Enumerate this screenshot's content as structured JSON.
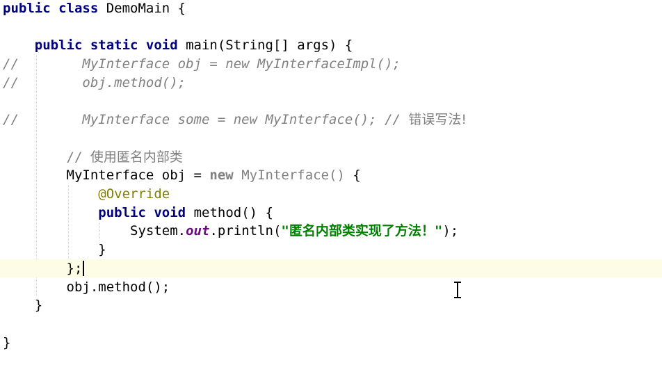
{
  "editor": {
    "language": "java",
    "lines": [
      {
        "tokens": [
          {
            "t": "public class",
            "c": "kw"
          },
          {
            "t": " DemoMain {",
            "c": ""
          }
        ]
      },
      {
        "tokens": []
      },
      {
        "tokens": [
          {
            "t": "    ",
            "c": ""
          },
          {
            "t": "public static void",
            "c": "kw"
          },
          {
            "t": " main(String[] args) {",
            "c": ""
          }
        ]
      },
      {
        "tokens": [
          {
            "t": "//",
            "c": "cm"
          },
          {
            "t": "        MyInterface obj = new MyInterfaceImpl();",
            "c": "cm"
          }
        ]
      },
      {
        "tokens": [
          {
            "t": "//",
            "c": "cm"
          },
          {
            "t": "        obj.method();",
            "c": "cm"
          }
        ]
      },
      {
        "tokens": []
      },
      {
        "tokens": [
          {
            "t": "//",
            "c": "cm"
          },
          {
            "t": "        MyInterface some = new MyInterface(); // ",
            "c": "cm"
          },
          {
            "t": "错误写法!",
            "c": "cm-plain cjk"
          }
        ]
      },
      {
        "tokens": []
      },
      {
        "tokens": [
          {
            "t": "        // ",
            "c": "cm-plain"
          },
          {
            "t": "使用匿名内部类",
            "c": "cm-plain cjk"
          }
        ]
      },
      {
        "tokens": [
          {
            "t": "        MyInterface obj = ",
            "c": ""
          },
          {
            "t": "new",
            "c": "gray-b"
          },
          {
            "t": " ",
            "c": ""
          },
          {
            "t": "MyInterface()",
            "c": "gray"
          },
          {
            "t": " {",
            "c": ""
          }
        ]
      },
      {
        "tokens": [
          {
            "t": "            ",
            "c": ""
          },
          {
            "t": "@Override",
            "c": "ann"
          }
        ]
      },
      {
        "tokens": [
          {
            "t": "            ",
            "c": ""
          },
          {
            "t": "public void",
            "c": "kw"
          },
          {
            "t": " method() {",
            "c": ""
          }
        ]
      },
      {
        "tokens": [
          {
            "t": "                System.",
            "c": ""
          },
          {
            "t": "out",
            "c": "fld"
          },
          {
            "t": ".println(",
            "c": ""
          },
          {
            "t": "\"",
            "c": "str"
          },
          {
            "t": "匿名内部类实现了方法！",
            "c": "str cjk"
          },
          {
            "t": "\"",
            "c": "str"
          },
          {
            "t": ");",
            "c": ""
          }
        ]
      },
      {
        "tokens": [
          {
            "t": "            }",
            "c": ""
          }
        ]
      },
      {
        "tokens": [
          {
            "t": "        };",
            "c": ""
          }
        ]
      },
      {
        "tokens": [
          {
            "t": "        obj.method();",
            "c": ""
          }
        ]
      },
      {
        "tokens": [
          {
            "t": "    }",
            "c": ""
          }
        ]
      },
      {
        "tokens": []
      },
      {
        "tokens": [
          {
            "t": "}",
            "c": ""
          }
        ]
      }
    ],
    "current_line_index": 14,
    "caret_line_index": 14
  },
  "colors": {
    "background": "#ffffff",
    "current_line": "#fdfde6",
    "keyword": "#000080",
    "comment": "#808080",
    "annotation": "#808000",
    "static_field": "#660e7a",
    "string": "#008000",
    "indent_guide": "#d8d8d8"
  },
  "icons": {
    "mouse_cursor": "text-ibeam-icon"
  }
}
